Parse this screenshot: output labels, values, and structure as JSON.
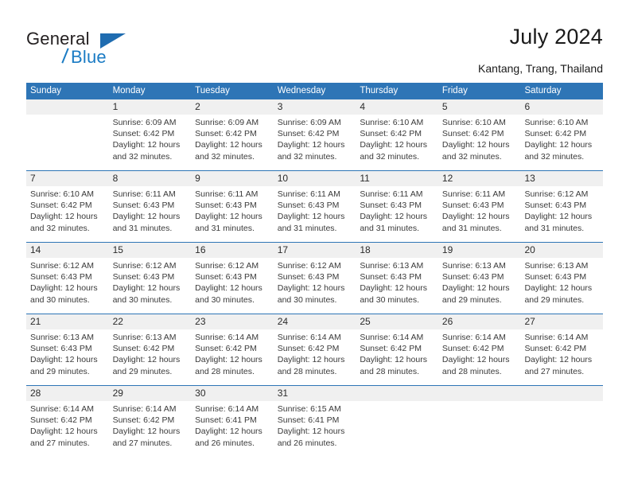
{
  "logo": {
    "word_one": "General",
    "word_two": "Blue",
    "triangle_icon": "triangle-icon"
  },
  "header": {
    "title": "July 2024",
    "location": "Kantang, Trang, Thailand"
  },
  "calendar": {
    "weekday_headers": [
      "Sunday",
      "Monday",
      "Tuesday",
      "Wednesday",
      "Thursday",
      "Friday",
      "Saturday"
    ],
    "weeks": [
      [
        {
          "day": "",
          "lines": []
        },
        {
          "day": "1",
          "lines": [
            "Sunrise: 6:09 AM",
            "Sunset: 6:42 PM",
            "Daylight: 12 hours",
            "and 32 minutes."
          ]
        },
        {
          "day": "2",
          "lines": [
            "Sunrise: 6:09 AM",
            "Sunset: 6:42 PM",
            "Daylight: 12 hours",
            "and 32 minutes."
          ]
        },
        {
          "day": "3",
          "lines": [
            "Sunrise: 6:09 AM",
            "Sunset: 6:42 PM",
            "Daylight: 12 hours",
            "and 32 minutes."
          ]
        },
        {
          "day": "4",
          "lines": [
            "Sunrise: 6:10 AM",
            "Sunset: 6:42 PM",
            "Daylight: 12 hours",
            "and 32 minutes."
          ]
        },
        {
          "day": "5",
          "lines": [
            "Sunrise: 6:10 AM",
            "Sunset: 6:42 PM",
            "Daylight: 12 hours",
            "and 32 minutes."
          ]
        },
        {
          "day": "6",
          "lines": [
            "Sunrise: 6:10 AM",
            "Sunset: 6:42 PM",
            "Daylight: 12 hours",
            "and 32 minutes."
          ]
        }
      ],
      [
        {
          "day": "7",
          "lines": [
            "Sunrise: 6:10 AM",
            "Sunset: 6:42 PM",
            "Daylight: 12 hours",
            "and 32 minutes."
          ]
        },
        {
          "day": "8",
          "lines": [
            "Sunrise: 6:11 AM",
            "Sunset: 6:43 PM",
            "Daylight: 12 hours",
            "and 31 minutes."
          ]
        },
        {
          "day": "9",
          "lines": [
            "Sunrise: 6:11 AM",
            "Sunset: 6:43 PM",
            "Daylight: 12 hours",
            "and 31 minutes."
          ]
        },
        {
          "day": "10",
          "lines": [
            "Sunrise: 6:11 AM",
            "Sunset: 6:43 PM",
            "Daylight: 12 hours",
            "and 31 minutes."
          ]
        },
        {
          "day": "11",
          "lines": [
            "Sunrise: 6:11 AM",
            "Sunset: 6:43 PM",
            "Daylight: 12 hours",
            "and 31 minutes."
          ]
        },
        {
          "day": "12",
          "lines": [
            "Sunrise: 6:11 AM",
            "Sunset: 6:43 PM",
            "Daylight: 12 hours",
            "and 31 minutes."
          ]
        },
        {
          "day": "13",
          "lines": [
            "Sunrise: 6:12 AM",
            "Sunset: 6:43 PM",
            "Daylight: 12 hours",
            "and 31 minutes."
          ]
        }
      ],
      [
        {
          "day": "14",
          "lines": [
            "Sunrise: 6:12 AM",
            "Sunset: 6:43 PM",
            "Daylight: 12 hours",
            "and 30 minutes."
          ]
        },
        {
          "day": "15",
          "lines": [
            "Sunrise: 6:12 AM",
            "Sunset: 6:43 PM",
            "Daylight: 12 hours",
            "and 30 minutes."
          ]
        },
        {
          "day": "16",
          "lines": [
            "Sunrise: 6:12 AM",
            "Sunset: 6:43 PM",
            "Daylight: 12 hours",
            "and 30 minutes."
          ]
        },
        {
          "day": "17",
          "lines": [
            "Sunrise: 6:12 AM",
            "Sunset: 6:43 PM",
            "Daylight: 12 hours",
            "and 30 minutes."
          ]
        },
        {
          "day": "18",
          "lines": [
            "Sunrise: 6:13 AM",
            "Sunset: 6:43 PM",
            "Daylight: 12 hours",
            "and 30 minutes."
          ]
        },
        {
          "day": "19",
          "lines": [
            "Sunrise: 6:13 AM",
            "Sunset: 6:43 PM",
            "Daylight: 12 hours",
            "and 29 minutes."
          ]
        },
        {
          "day": "20",
          "lines": [
            "Sunrise: 6:13 AM",
            "Sunset: 6:43 PM",
            "Daylight: 12 hours",
            "and 29 minutes."
          ]
        }
      ],
      [
        {
          "day": "21",
          "lines": [
            "Sunrise: 6:13 AM",
            "Sunset: 6:43 PM",
            "Daylight: 12 hours",
            "and 29 minutes."
          ]
        },
        {
          "day": "22",
          "lines": [
            "Sunrise: 6:13 AM",
            "Sunset: 6:42 PM",
            "Daylight: 12 hours",
            "and 29 minutes."
          ]
        },
        {
          "day": "23",
          "lines": [
            "Sunrise: 6:14 AM",
            "Sunset: 6:42 PM",
            "Daylight: 12 hours",
            "and 28 minutes."
          ]
        },
        {
          "day": "24",
          "lines": [
            "Sunrise: 6:14 AM",
            "Sunset: 6:42 PM",
            "Daylight: 12 hours",
            "and 28 minutes."
          ]
        },
        {
          "day": "25",
          "lines": [
            "Sunrise: 6:14 AM",
            "Sunset: 6:42 PM",
            "Daylight: 12 hours",
            "and 28 minutes."
          ]
        },
        {
          "day": "26",
          "lines": [
            "Sunrise: 6:14 AM",
            "Sunset: 6:42 PM",
            "Daylight: 12 hours",
            "and 28 minutes."
          ]
        },
        {
          "day": "27",
          "lines": [
            "Sunrise: 6:14 AM",
            "Sunset: 6:42 PM",
            "Daylight: 12 hours",
            "and 27 minutes."
          ]
        }
      ],
      [
        {
          "day": "28",
          "lines": [
            "Sunrise: 6:14 AM",
            "Sunset: 6:42 PM",
            "Daylight: 12 hours",
            "and 27 minutes."
          ]
        },
        {
          "day": "29",
          "lines": [
            "Sunrise: 6:14 AM",
            "Sunset: 6:42 PM",
            "Daylight: 12 hours",
            "and 27 minutes."
          ]
        },
        {
          "day": "30",
          "lines": [
            "Sunrise: 6:14 AM",
            "Sunset: 6:41 PM",
            "Daylight: 12 hours",
            "and 26 minutes."
          ]
        },
        {
          "day": "31",
          "lines": [
            "Sunrise: 6:15 AM",
            "Sunset: 6:41 PM",
            "Daylight: 12 hours",
            "and 26 minutes."
          ]
        },
        {
          "day": "",
          "lines": []
        },
        {
          "day": "",
          "lines": []
        },
        {
          "day": "",
          "lines": []
        }
      ]
    ]
  },
  "colors": {
    "header_blue": "#2e75b6",
    "daynum_band": "#f0f0f0",
    "logo_blue": "#1a7bc4",
    "text": "#3a3a3a"
  }
}
